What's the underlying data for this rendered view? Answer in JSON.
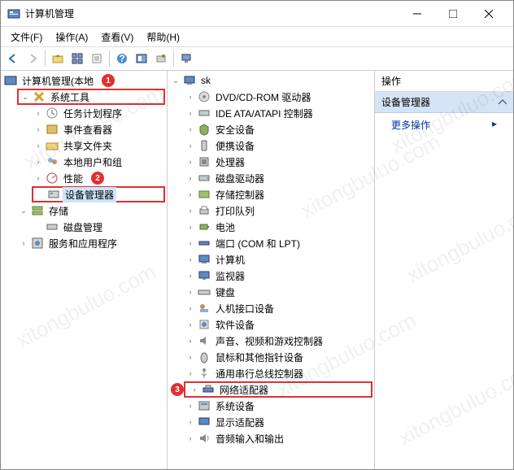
{
  "window": {
    "title": "计算机管理"
  },
  "menu": {
    "file": "文件(F)",
    "action": "操作(A)",
    "view": "查看(V)",
    "help": "帮助(H)"
  },
  "leftTree": {
    "root": "计算机管理(本地",
    "systemTools": "系统工具",
    "taskScheduler": "任务计划程序",
    "eventViewer": "事件查看器",
    "sharedFolders": "共享文件夹",
    "localUsers": "本地用户和组",
    "performance": "性能",
    "deviceManager": "设备管理器",
    "storage": "存储",
    "diskMgmt": "磁盘管理",
    "services": "服务和应用程序"
  },
  "midTree": {
    "root": "sk",
    "dvd": "DVD/CD-ROM 驱动器",
    "ide": "IDE ATA/ATAPI 控制器",
    "security": "安全设备",
    "portable": "便携设备",
    "cpu": "处理器",
    "diskDrive": "磁盘驱动器",
    "storageCtrl": "存储控制器",
    "printQueue": "打印队列",
    "battery": "电池",
    "ports": "端口 (COM 和 LPT)",
    "computer": "计算机",
    "monitor": "监视器",
    "keyboard": "键盘",
    "hid": "人机接口设备",
    "software": "软件设备",
    "sound": "声音、视频和游戏控制器",
    "mouse": "鼠标和其他指针设备",
    "usb": "通用串行总线控制器",
    "network": "网络适配器",
    "system": "系统设备",
    "display": "显示适配器",
    "audio": "音频输入和输出"
  },
  "actions": {
    "header": "操作",
    "section": "设备管理器",
    "more": "更多操作"
  },
  "badges": {
    "b1": "1",
    "b2": "2",
    "b3": "3"
  },
  "watermark": "xitongbuluo.com"
}
